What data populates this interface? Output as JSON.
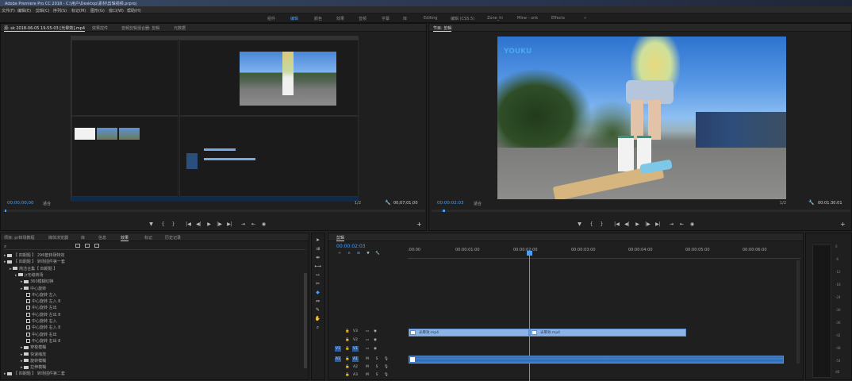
{
  "app": {
    "title": "Adobe Premiere Pro CC 2018 - C:\\用户\\Desktop\\素材\\剪辑视频.prproj"
  },
  "menu": [
    "文件(F)",
    "编辑(E)",
    "剪辑(C)",
    "序列(S)",
    "标记(M)",
    "图形(G)",
    "窗口(W)",
    "帮助(H)"
  ],
  "workspaces": {
    "items": [
      "组件",
      "编辑",
      "颜色",
      "效果",
      "音频",
      "字幕",
      "库",
      "Editing",
      "编辑 (CS5.5)",
      "Zone_hi",
      "Mine - unk",
      "Effects"
    ],
    "active": "编辑",
    "more": "»"
  },
  "source_monitor": {
    "tabs": [
      "源: sk 2018-06-05 19-55-03 [光晕效].mp4",
      "元数据",
      "效果控件",
      "音频剪辑混合器: 剪辑",
      "元数据"
    ],
    "timecode_in": "00;00;00;00",
    "fit": "适合",
    "res": "1/2",
    "duration": "00;07;01;00"
  },
  "program_monitor": {
    "tab": "节目: 剪辑",
    "timecode": "00:00:02:03",
    "fit": "适合",
    "res": "1/2",
    "duration": "00:01:30:01",
    "watermark": "YOUKU"
  },
  "controls": [
    "▼",
    "{",
    "}",
    "|◀",
    "◀|",
    "▶",
    "|▶",
    "▶|",
    "⇥",
    "⇤",
    "◉"
  ],
  "effects_panel": {
    "tabs": [
      "项目: pr转场教程",
      "媒体浏览器",
      "库",
      "信息",
      "效果",
      "标记",
      "历史记录"
    ],
    "active_tab": "效果",
    "tree": [
      {
        "type": "folder",
        "label": "【 四期题 】 296套转场特效",
        "indent": 0
      },
      {
        "type": "folder",
        "label": "【 四期题 】 转场插件第一套",
        "indent": 0
      },
      {
        "type": "folder",
        "label": "简洁合集【 四期题 】",
        "indent": 1
      },
      {
        "type": "folder",
        "label": "jr无缝转场",
        "indent": 2
      },
      {
        "type": "folder",
        "label": "360模糊切换",
        "indent": 3
      },
      {
        "type": "folder",
        "label": "中心旋转",
        "indent": 3
      },
      {
        "type": "fx",
        "label": "中心旋转 左入",
        "indent": 4
      },
      {
        "type": "fx",
        "label": "中心旋转 左入 8",
        "indent": 4
      },
      {
        "type": "fx",
        "label": "中心旋转 左出",
        "indent": 4
      },
      {
        "type": "fx",
        "label": "中心旋转 左出 8",
        "indent": 4
      },
      {
        "type": "fx",
        "label": "中心旋转 右入",
        "indent": 4
      },
      {
        "type": "fx",
        "label": "中心旋转 右入 8",
        "indent": 4
      },
      {
        "type": "fx",
        "label": "中心旋转 右出",
        "indent": 4
      },
      {
        "type": "fx",
        "label": "中心旋转 右出 8",
        "indent": 4
      },
      {
        "type": "folder",
        "label": "穿梭模糊",
        "indent": 3
      },
      {
        "type": "folder",
        "label": "快速缩放",
        "indent": 3
      },
      {
        "type": "folder",
        "label": "旋转模糊",
        "indent": 3
      },
      {
        "type": "folder",
        "label": "拉伸模糊",
        "indent": 3
      },
      {
        "type": "folder",
        "label": "【 四期题 】 转场插件第二套",
        "indent": 0
      }
    ]
  },
  "timeline": {
    "tab": "剪辑",
    "timecode": "00:00:02:03",
    "ruler": [
      ":00:00",
      "00:00:01:00",
      "00:00:02:00",
      "00:00:03:00",
      "00:00:04:00",
      "00:00:05:00",
      "00:00:06:00"
    ],
    "video_tracks": [
      "V3",
      "V2",
      "V1"
    ],
    "audio_tracks": [
      "A1",
      "A2",
      "A3"
    ],
    "clips": [
      {
        "label": "光晕效.mp4"
      },
      {
        "label": "光晕效.mp4"
      }
    ],
    "meter_scale": [
      "0",
      "-6",
      "-12",
      "-18",
      "-24",
      "-30",
      "-36",
      "-42",
      "-48",
      "-54",
      "dB"
    ]
  },
  "colors": {
    "accent": "#4c9ef5",
    "clip_video": "#8cb4e6",
    "clip_audio": "#3e7bc4"
  }
}
